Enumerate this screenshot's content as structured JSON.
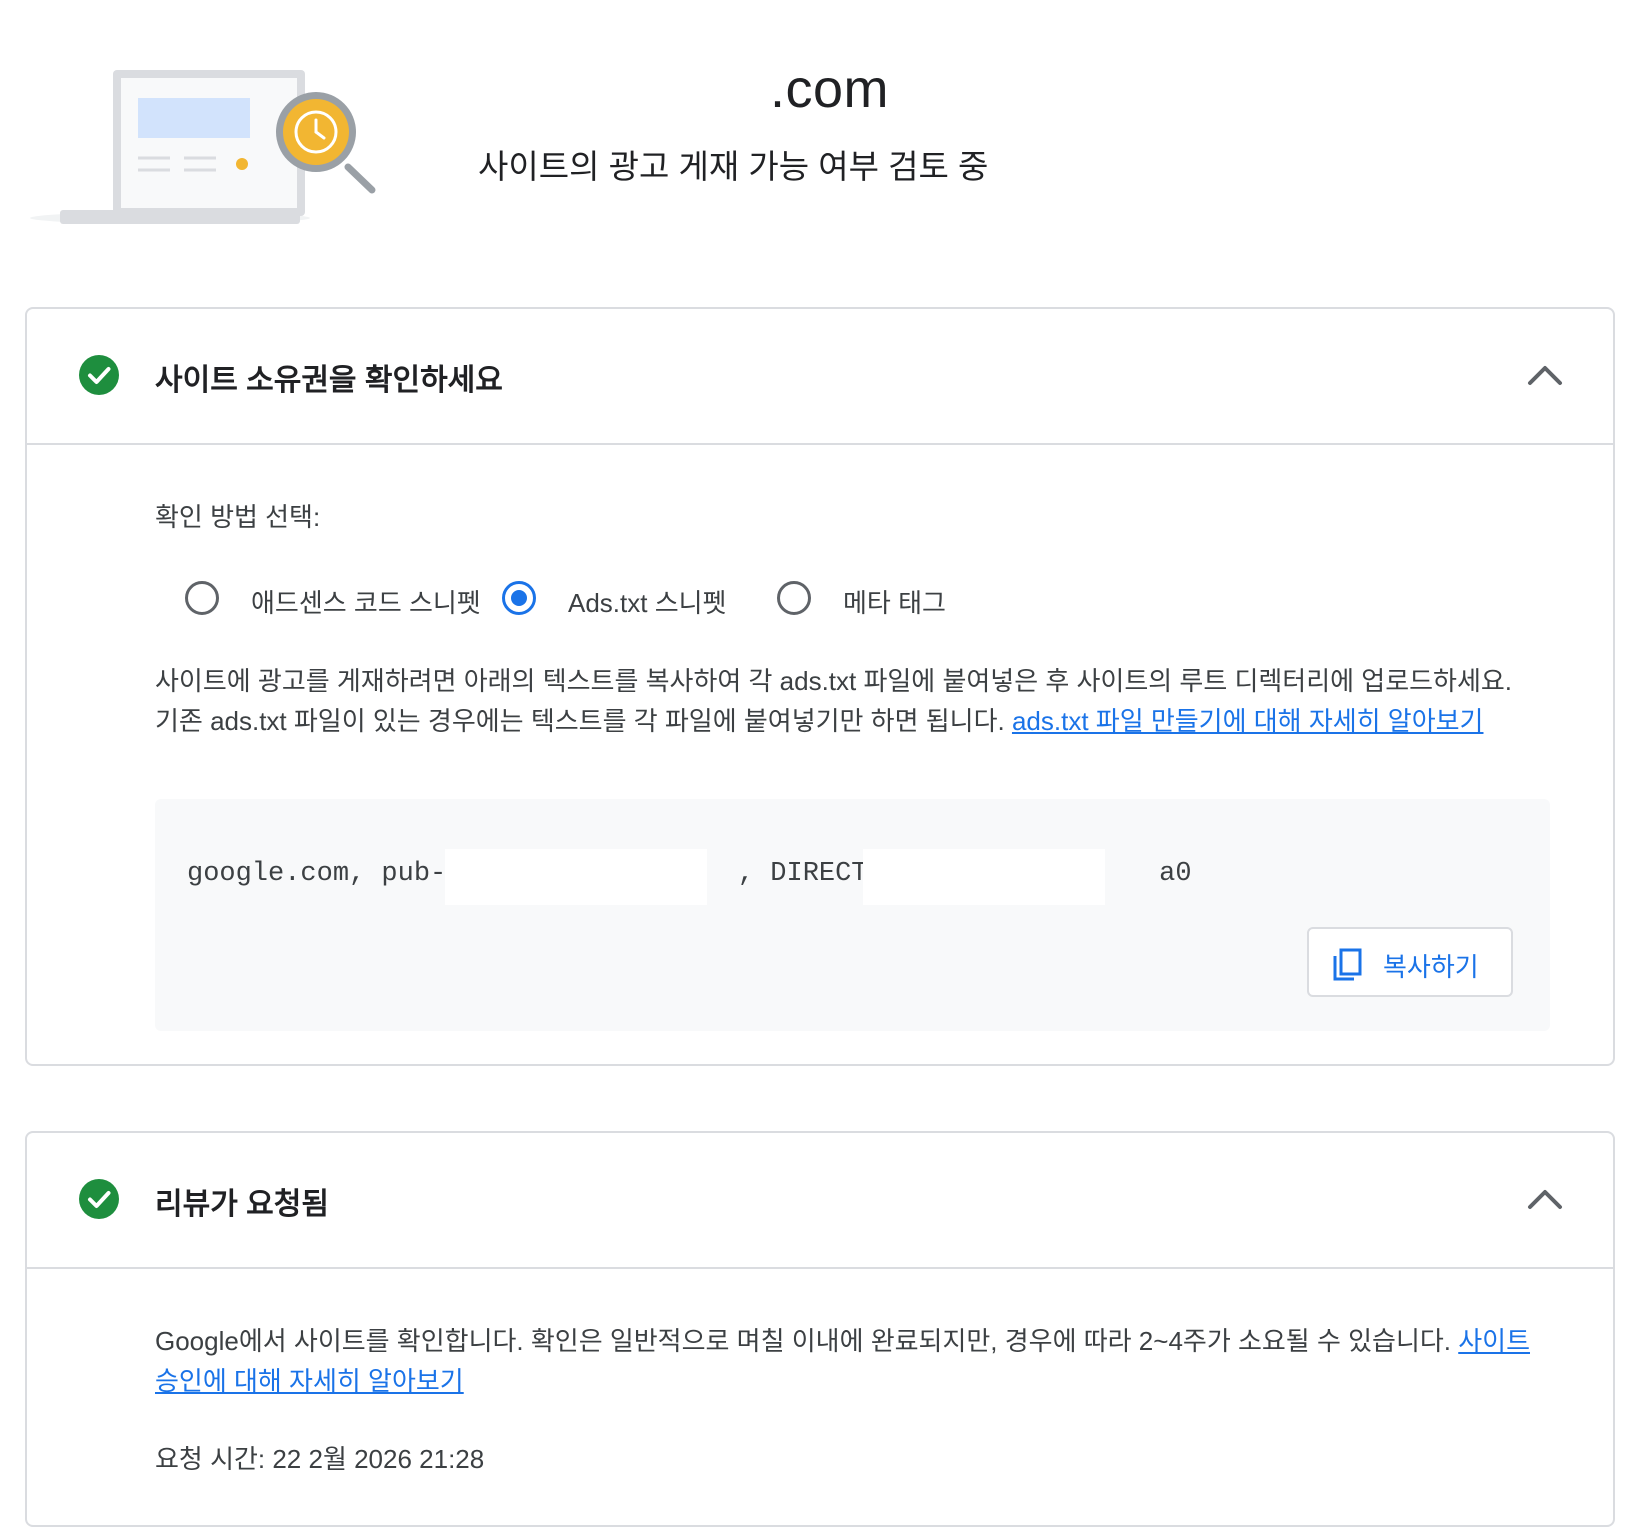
{
  "header": {
    "domain": ".com",
    "subtitle": "사이트의 광고 게재 가능 여부 검토 중"
  },
  "icons": {
    "illustration": "site-review-illustration",
    "status": "check-circle-icon",
    "collapse": "chevron-up-icon",
    "copy": "copy-icon"
  },
  "colors": {
    "accent": "#1a73e8",
    "success": "#1e8e3e",
    "illustration_yellow": "#f2b632"
  },
  "ownership": {
    "title": "사이트 소유권을 확인하세요",
    "method_label": "확인 방법 선택:",
    "options": [
      {
        "label": "애드센스 코드 스니펫",
        "selected": false
      },
      {
        "label": "Ads.txt 스니펫",
        "selected": true
      },
      {
        "label": "메타 태그",
        "selected": false
      }
    ],
    "description": "사이트에 광고를 게재하려면 아래의 텍스트를 복사하여 각 ads.txt 파일에 붙여넣은 후 사이트의 루트 디렉터리에 업로드하세요. 기존 ads.txt 파일이 있는 경우에는 텍스트를 각 파일에 붙여넣기만 하면 됩니다. ",
    "learn_more_link": "ads.txt 파일 만들기에 대해 자세히 알아보기",
    "snippet": "google.com, pub-                  , DIRECT,                 a0",
    "copy_button": "복사하기"
  },
  "review": {
    "title": "리뷰가 요청됨",
    "description": "Google에서 사이트를 확인합니다. 확인은 일반적으로 며칠 이내에 완료되지만, 경우에 따라 2~4주가 소요될 수 있습니다. ",
    "learn_more_link": "사이트 승인에 대해 자세히 알아보기",
    "request_time": "요청 시간: 22 2월 2026 21:28"
  }
}
